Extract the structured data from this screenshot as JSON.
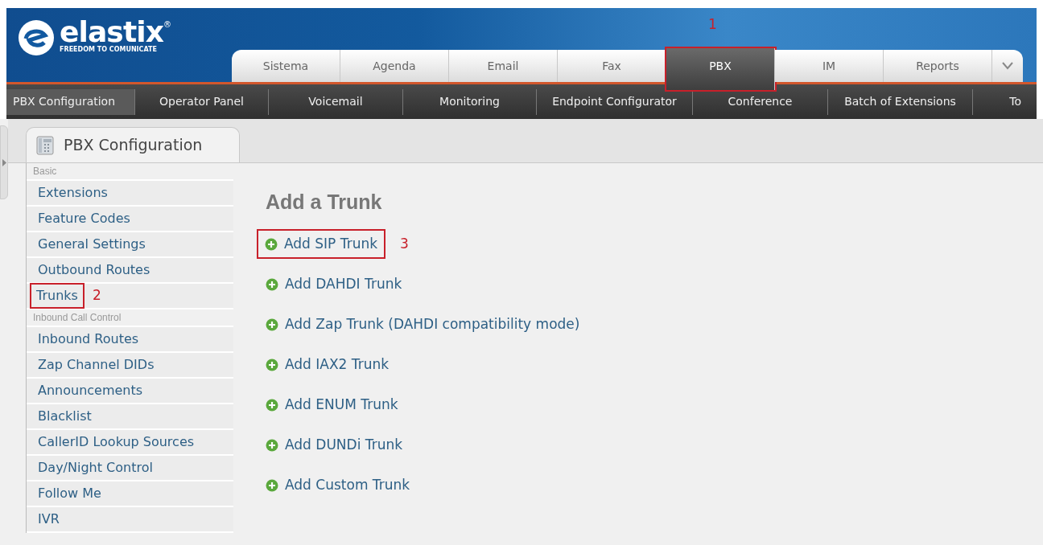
{
  "logo": {
    "name": "elastix",
    "tagline": "FREEDOM TO COMUNICATE",
    "mark": "®"
  },
  "main_tabs": [
    {
      "label": "Sistema",
      "selected": false
    },
    {
      "label": "Agenda",
      "selected": false
    },
    {
      "label": "Email",
      "selected": false
    },
    {
      "label": "Fax",
      "selected": false
    },
    {
      "label": "PBX",
      "selected": true,
      "annotation": "1"
    },
    {
      "label": "IM",
      "selected": false
    },
    {
      "label": "Reports",
      "selected": false
    }
  ],
  "sub_menu": [
    {
      "label": "PBX Configuration",
      "selected": true
    },
    {
      "label": "Operator Panel",
      "selected": false
    },
    {
      "label": "Voicemail",
      "selected": false
    },
    {
      "label": "Monitoring",
      "selected": false
    },
    {
      "label": "Endpoint Configurator",
      "selected": false
    },
    {
      "label": "Conference",
      "selected": false
    },
    {
      "label": "Batch of Extensions",
      "selected": false
    },
    {
      "label": "To",
      "selected": false
    }
  ],
  "sidebar": {
    "title": "PBX Configuration",
    "groups": [
      {
        "heading": "Basic",
        "items": [
          {
            "label": "Extensions"
          },
          {
            "label": "Feature Codes"
          },
          {
            "label": "General Settings"
          },
          {
            "label": "Outbound Routes"
          },
          {
            "label": "Trunks",
            "annotation": "2"
          }
        ]
      },
      {
        "heading": "Inbound Call Control",
        "items": [
          {
            "label": "Inbound Routes"
          },
          {
            "label": "Zap Channel DIDs"
          },
          {
            "label": "Announcements"
          },
          {
            "label": "Blacklist"
          },
          {
            "label": "CallerID Lookup Sources"
          },
          {
            "label": "Day/Night Control"
          },
          {
            "label": "Follow Me"
          },
          {
            "label": "IVR"
          }
        ]
      }
    ]
  },
  "content": {
    "title": "Add a Trunk",
    "links": [
      {
        "label": "Add SIP Trunk",
        "annotation": "3"
      },
      {
        "label": "Add DAHDI Trunk"
      },
      {
        "label": "Add Zap Trunk (DAHDI compatibility mode)"
      },
      {
        "label": "Add IAX2 Trunk"
      },
      {
        "label": "Add ENUM Trunk"
      },
      {
        "label": "Add DUNDi Trunk"
      },
      {
        "label": "Add Custom Trunk"
      }
    ]
  }
}
